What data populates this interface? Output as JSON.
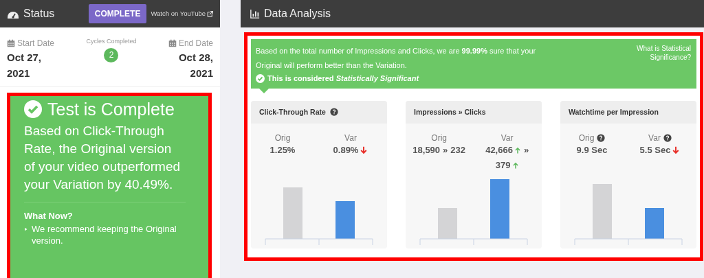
{
  "status_panel": {
    "title": "Status",
    "badge": "COMPLETE",
    "link": "Watch on YouTube",
    "start": {
      "label": "Start Date",
      "value": "Oct 27, 2021"
    },
    "cycles": {
      "label": "Cycles Completed",
      "value": "2"
    },
    "end": {
      "label": "End Date",
      "value": "Oct 28, 2021"
    },
    "result": {
      "title": "Test is Complete",
      "text": "Based on Click-Through Rate, the Original version of your video outperformed your Variation by 40.49%.",
      "what_now": "What Now?",
      "recommendation": "We recommend keeping the Original version."
    }
  },
  "analysis_panel": {
    "title": "Data Analysis",
    "banner": {
      "text": "Based on the total number of Impressions and Clicks, we are **99.99%** sure that your Original will perform better than the Variation.",
      "verdict": "This is considered *Statistically Significant*",
      "link": "What is Statistical Significance?"
    },
    "cards": [
      {
        "title": "Click-Through Rate",
        "help": true,
        "orig": {
          "label": "Orig",
          "parts": [
            {
              "text": "1.25%"
            }
          ]
        },
        "var": {
          "label": "Var",
          "parts": [
            {
              "text": "0.89%",
              "rising": false
            }
          ]
        }
      },
      {
        "title": "Impressions » Clicks",
        "orig": {
          "label": "Orig",
          "parts": [
            {
              "text": "18,590"
            },
            {
              "text": "»"
            },
            {
              "text": "232"
            }
          ]
        },
        "var": {
          "label": "Var",
          "parts": [
            {
              "text": "42,666",
              "rising": true
            },
            {
              "text": "»"
            },
            {
              "text": "379",
              "rising": true
            }
          ]
        }
      },
      {
        "title": "Watchtime per Impression",
        "orig": {
          "label": "Orig",
          "help": true,
          "parts": [
            {
              "text": "9.9 Sec"
            }
          ]
        },
        "var": {
          "label": "Var",
          "help": true,
          "parts": [
            {
              "text": "5.5 Sec",
              "rising": false
            }
          ]
        }
      }
    ]
  }
}
